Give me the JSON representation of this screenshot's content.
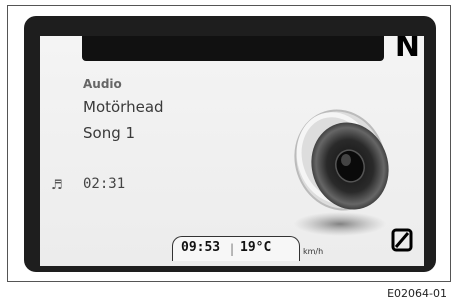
{
  "display": {
    "gear": "N",
    "audio_label": "Audio",
    "artist": "Motörhead",
    "song": "Song 1",
    "elapsed": "02:31",
    "note_icon": "♬"
  },
  "status_bar": {
    "clock": "09:53",
    "divider": "|",
    "temperature": "19°C",
    "speed_unit": "km/h"
  },
  "figure_id": "E02064-01",
  "icons": [
    "music-note-icon",
    "speaker-icon",
    "zero-speed-icon"
  ]
}
